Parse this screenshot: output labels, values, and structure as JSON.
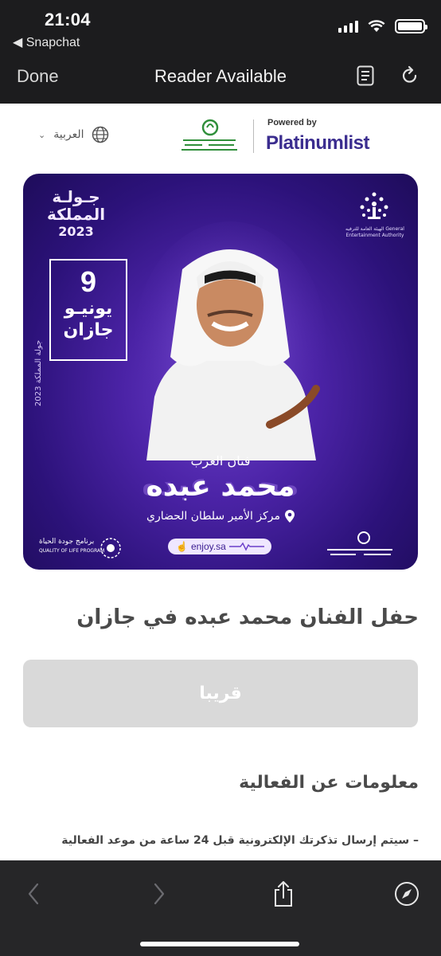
{
  "status_bar": {
    "time": "21:04",
    "back_app": "◀ Snapchat",
    "battery_level": 1.0
  },
  "nav": {
    "done": "Done",
    "title": "Reader Available",
    "reader_icon": "reader-icon",
    "reload_icon": "reload-icon"
  },
  "site_header": {
    "language": "العربية",
    "powered_by": "Powered by",
    "platinumlist": "Platinumlist"
  },
  "banner": {
    "tour_line1": "جـولـة",
    "tour_line2": "المملكة",
    "tour_year": "2023",
    "day": "9",
    "month": "يونيـو",
    "city": "جازان",
    "side_text": "جولة المملكة 2023",
    "gea_text": "الهيئة العامة للترفيه General Entertainment Authority",
    "artist_title": "فنان العرب",
    "artist_name": "محمد عبده",
    "venue": "مركز الأمير سلطان الحضاري",
    "enjoy": "enjoy.sa",
    "qol_ar": "برنامج جودة الحياة",
    "qol_en": "QUALITY OF LIFE PROGRAM",
    "colors": {
      "bg": "#2c127a",
      "accent": "#6a3ec9"
    }
  },
  "event": {
    "title": "حفل الفنان محمد عبده في جازان",
    "button": "قريبا",
    "info_heading": "معلومات عن الفعالية",
    "info_text": "– سيتم إرسال تذكرتك الإلكترونية قبل 24 ساعة من موعد الفعالية"
  },
  "toolbar": {
    "back": "chevron-left-icon",
    "forward": "chevron-right-icon",
    "share": "share-icon",
    "compass": "compass-icon"
  }
}
